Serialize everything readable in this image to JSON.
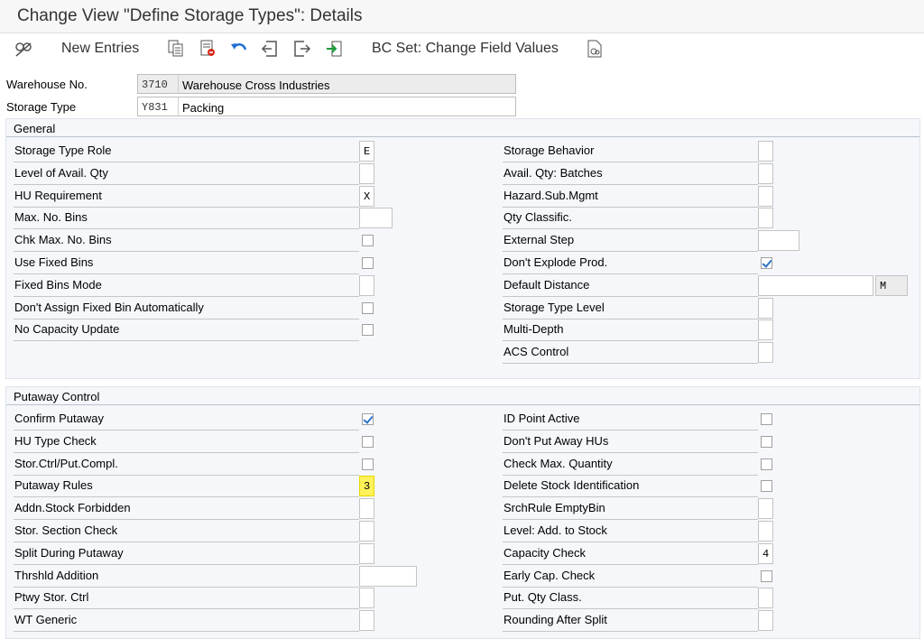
{
  "window": {
    "title": "Change View \"Define Storage Types\": Details"
  },
  "toolbar": {
    "new_entries": "New Entries",
    "bc_set": "BC Set: Change Field Values",
    "icons": [
      "display-change-icon",
      "copy-icon",
      "delete-icon",
      "undo-icon",
      "previous-entry-icon",
      "next-entry-icon",
      "select-icon",
      "bc-set-icon"
    ]
  },
  "header": {
    "warehouse_label": "Warehouse No.",
    "warehouse_code": "3710",
    "warehouse_desc": "Warehouse Cross Industries",
    "storage_type_label": "Storage Type",
    "storage_type_code": "Y831",
    "storage_type_desc": "Packing"
  },
  "general": {
    "title": "General",
    "left": [
      {
        "label": "Storage Type Role",
        "type": "field",
        "value": "E"
      },
      {
        "label": "Level of Avail. Qty",
        "type": "field",
        "value": ""
      },
      {
        "label": "HU Requirement",
        "type": "field",
        "value": "X"
      },
      {
        "label": "Max. No. Bins",
        "type": "field",
        "value": ""
      },
      {
        "label": "Chk Max. No. Bins",
        "type": "checkbox",
        "checked": false
      },
      {
        "label": "Use Fixed Bins",
        "type": "checkbox",
        "checked": false
      },
      {
        "label": "Fixed Bins Mode",
        "type": "field",
        "value": ""
      },
      {
        "label": "Don't Assign Fixed Bin Automatically",
        "type": "checkbox",
        "checked": false
      },
      {
        "label": "No Capacity Update",
        "type": "checkbox",
        "checked": false
      }
    ],
    "right": [
      {
        "label": "Storage Behavior",
        "type": "field",
        "value": ""
      },
      {
        "label": "Avail. Qty: Batches",
        "type": "field",
        "value": ""
      },
      {
        "label": "Hazard.Sub.Mgmt",
        "type": "field",
        "value": ""
      },
      {
        "label": "Qty Classific.",
        "type": "field",
        "value": ""
      },
      {
        "label": "External Step",
        "type": "field",
        "value": ""
      },
      {
        "label": "Don't Explode Prod.",
        "type": "checkbox",
        "checked": true
      },
      {
        "label": "Default Distance",
        "type": "field",
        "value": "",
        "unit": "M"
      },
      {
        "label": "Storage Type Level",
        "type": "field",
        "value": ""
      },
      {
        "label": "Multi-Depth",
        "type": "field",
        "value": ""
      },
      {
        "label": "ACS Control",
        "type": "field",
        "value": ""
      }
    ]
  },
  "putaway": {
    "title": "Putaway Control",
    "left": [
      {
        "label": "Confirm Putaway",
        "type": "checkbox",
        "checked": true
      },
      {
        "label": "HU Type Check",
        "type": "checkbox",
        "checked": false
      },
      {
        "label": "Stor.Ctrl/Put.Compl.",
        "type": "checkbox",
        "checked": false
      },
      {
        "label": "Putaway Rules",
        "type": "field",
        "value": "3"
      },
      {
        "label": "Addn.Stock Forbidden",
        "type": "field",
        "value": ""
      },
      {
        "label": "Stor. Section Check",
        "type": "field",
        "value": ""
      },
      {
        "label": "Split During Putaway",
        "type": "field",
        "value": ""
      },
      {
        "label": "Thrshld Addition",
        "type": "field",
        "value": ""
      },
      {
        "label": "Ptwy Stor. Ctrl",
        "type": "field",
        "value": ""
      },
      {
        "label": "WT Generic",
        "type": "field",
        "value": ""
      }
    ],
    "right": [
      {
        "label": "ID Point Active",
        "type": "checkbox",
        "checked": false
      },
      {
        "label": "Don't Put Away HUs",
        "type": "checkbox",
        "checked": false
      },
      {
        "label": "Check Max. Quantity",
        "type": "checkbox",
        "checked": false
      },
      {
        "label": "Delete Stock Identification",
        "type": "checkbox",
        "checked": false
      },
      {
        "label": "SrchRule EmptyBin",
        "type": "field",
        "value": ""
      },
      {
        "label": "Level: Add. to Stock",
        "type": "field",
        "value": ""
      },
      {
        "label": "Capacity Check",
        "type": "field",
        "value": "4"
      },
      {
        "label": "Early Cap. Check",
        "type": "checkbox",
        "checked": false
      },
      {
        "label": "Put. Qty Class.",
        "type": "field",
        "value": ""
      },
      {
        "label": "Rounding After Split",
        "type": "field",
        "value": ""
      }
    ]
  },
  "colors": {
    "highlight": "#fff25a",
    "check": "#2b73c7",
    "section_bg": "#f5f7fa"
  }
}
